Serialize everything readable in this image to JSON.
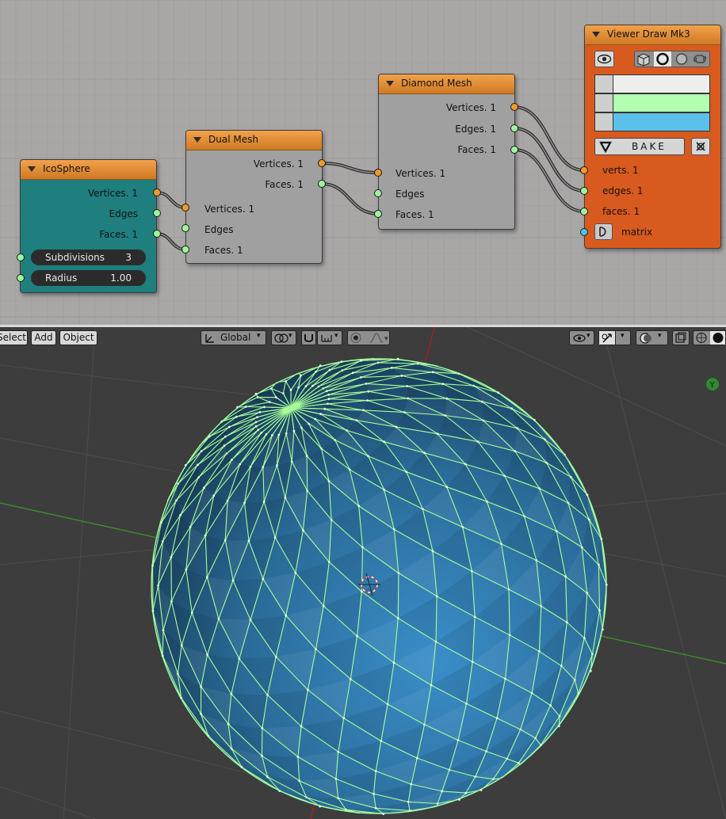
{
  "node_editor": {
    "nodes": {
      "icosphere": {
        "title": "IcoSphere",
        "outputs": [
          "Vertices. 1",
          "Edges",
          "Faces. 1"
        ],
        "params": [
          {
            "label": "Subdivisions",
            "value": "3"
          },
          {
            "label": "Radius",
            "value": "1.00"
          }
        ]
      },
      "dual_mesh": {
        "title": "Dual Mesh",
        "outputs": [
          "Vertices. 1",
          "Faces. 1"
        ],
        "inputs": [
          "Vertices. 1",
          "Edges",
          "Faces. 1"
        ]
      },
      "diamond_mesh": {
        "title": "Diamond Mesh",
        "outputs": [
          "Vertices. 1",
          "Edges. 1",
          "Faces. 1"
        ],
        "inputs": [
          "Vertices. 1",
          "Edges",
          "Faces. 1"
        ]
      },
      "viewer": {
        "title": "Viewer Draw Mk3",
        "bake_label": "BAKE",
        "inputs": [
          "verts. 1",
          "edges. 1",
          "faces. 1",
          "matrix"
        ],
        "color_rows": [
          "#eeeeee",
          "#b3ffb0",
          "#5cc1ea"
        ],
        "header_color": "#d95a1e",
        "icons": [
          "eye-icon",
          "cube-icon",
          "circle-icon",
          "sphere-icon",
          "link-icon",
          "bake-triangle-icon",
          "close-cross-icon"
        ]
      }
    }
  },
  "viewport_header": {
    "menu": [
      "Select",
      "Add",
      "Object"
    ],
    "orientation": "Global"
  },
  "viewport": {
    "axis_gizmo_label": "Y",
    "mesh_fill_color": "#2f7fb3",
    "wire_color": "#a9ff98"
  }
}
